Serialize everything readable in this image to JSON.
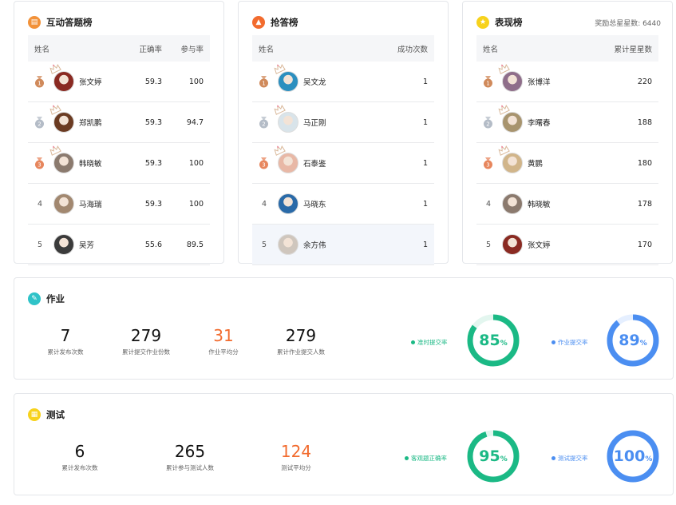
{
  "colors": {
    "green": "#1bb985",
    "blue": "#4b8ef1",
    "orange": "#f26b2e",
    "gold": "#f7d21c",
    "teal": "#2fc3c8",
    "bronze": "#d08a5b",
    "silver": "#b4bcc7",
    "copper": "#e7865d"
  },
  "answer_board": {
    "title": "互动答题榜",
    "headers": {
      "name": "姓名",
      "accuracy": "正确率",
      "participation": "参与率"
    },
    "rows": [
      {
        "rank": "1",
        "name": "张文婷",
        "accuracy": "59.3",
        "participation": "100",
        "avatar_color": "#8a2a22"
      },
      {
        "rank": "2",
        "name": "郑凯鹏",
        "accuracy": "59.3",
        "participation": "94.7",
        "avatar_color": "#6b3b22"
      },
      {
        "rank": "3",
        "name": "韩晓敏",
        "accuracy": "59.3",
        "participation": "100",
        "avatar_color": "#8b7a6e"
      },
      {
        "rank": "4",
        "name": "马海瑞",
        "accuracy": "59.3",
        "participation": "100",
        "avatar_color": "#a28870"
      },
      {
        "rank": "5",
        "name": "吴芳",
        "accuracy": "55.6",
        "participation": "89.5",
        "avatar_color": "#3b3b3b"
      }
    ]
  },
  "grab_board": {
    "title": "抢答榜",
    "headers": {
      "name": "姓名",
      "success": "成功次数"
    },
    "rows": [
      {
        "rank": "1",
        "name": "吴文龙",
        "success": "1",
        "avatar_color": "#2c8fbf"
      },
      {
        "rank": "2",
        "name": "马正刚",
        "success": "1",
        "avatar_color": "#d9e4ea"
      },
      {
        "rank": "3",
        "name": "石泰鉴",
        "success": "1",
        "avatar_color": "#e8b8a6"
      },
      {
        "rank": "4",
        "name": "马晓东",
        "success": "1",
        "avatar_color": "#2a6aa8"
      },
      {
        "rank": "5",
        "name": "余方伟",
        "success": "1",
        "avatar_color": "#cfc6bd"
      }
    ]
  },
  "perf_board": {
    "title": "表现榜",
    "extra": "奖励总星星数: 6440",
    "headers": {
      "name": "姓名",
      "stars": "累计星星数"
    },
    "rows": [
      {
        "rank": "1",
        "name": "张博洋",
        "stars": "220",
        "avatar_color": "#8f6e8a"
      },
      {
        "rank": "2",
        "name": "李曙春",
        "stars": "188",
        "avatar_color": "#a8946e"
      },
      {
        "rank": "3",
        "name": "黄鹏",
        "stars": "180",
        "avatar_color": "#d1b58a"
      },
      {
        "rank": "4",
        "name": "韩晓敏",
        "stars": "178",
        "avatar_color": "#8b7a6e"
      },
      {
        "rank": "5",
        "name": "张文婷",
        "stars": "170",
        "avatar_color": "#8a2a22"
      }
    ]
  },
  "homework": {
    "title": "作业",
    "stats": [
      {
        "value": "7",
        "label": "累计发布次数",
        "highlight": false
      },
      {
        "value": "279",
        "label": "累计提交作业份数",
        "highlight": false
      },
      {
        "value": "31",
        "label": "作业平均分",
        "highlight": true
      },
      {
        "value": "279",
        "label": "累计作业提交人数",
        "highlight": false
      }
    ],
    "rings": [
      {
        "legend": "准时提交率",
        "value": "85",
        "unit": "%",
        "fraction": 0.85,
        "color": "#1bb985",
        "track": "#e3f6ef"
      },
      {
        "legend": "作业提交率",
        "value": "89",
        "unit": "%",
        "fraction": 0.89,
        "color": "#4b8ef1",
        "track": "#e5efff"
      }
    ]
  },
  "test": {
    "title": "测试",
    "stats": [
      {
        "value": "6",
        "label": "累计发布次数",
        "highlight": false
      },
      {
        "value": "265",
        "label": "累计参与测试人数",
        "highlight": false
      },
      {
        "value": "124",
        "label": "测试平均分",
        "highlight": true
      }
    ],
    "rings": [
      {
        "legend": "客观题正确率",
        "value": "95",
        "unit": "%",
        "fraction": 0.95,
        "color": "#1bb985",
        "track": "#e3f6ef"
      },
      {
        "legend": "测试提交率",
        "value": "100",
        "unit": "%",
        "fraction": 1.0,
        "color": "#4b8ef1",
        "track": "#e5efff"
      }
    ]
  }
}
